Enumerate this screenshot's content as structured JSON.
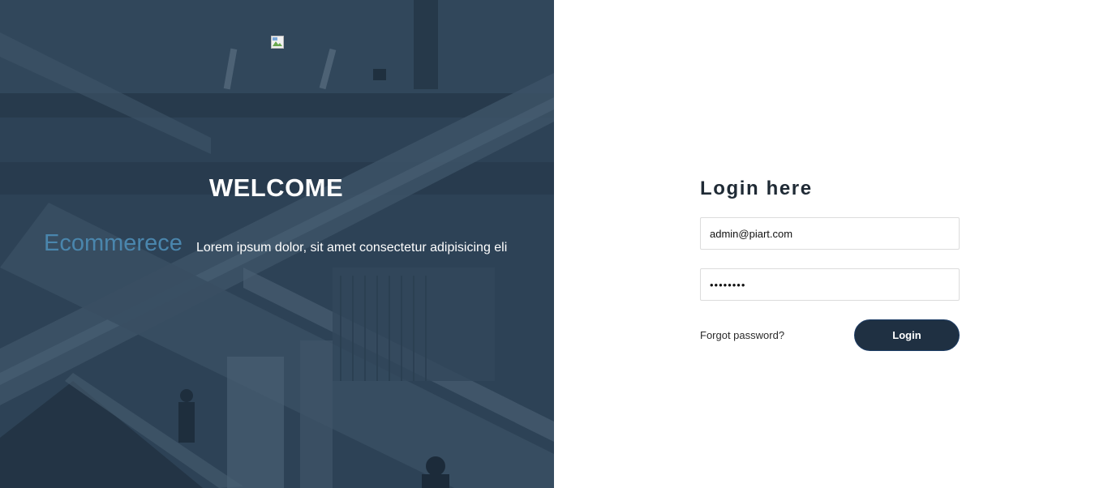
{
  "hero": {
    "logo_icon": "broken-image-icon",
    "title": "WELCOME",
    "brand": "Ecommerece",
    "tagline": "Lorem ipsum dolor, sit amet consectetur adipisicing eli",
    "background_image": "escalators-in-shopping-mall",
    "colors": {
      "overlay": "#2f4559",
      "brand": "#4a86ad",
      "text": "#ffffff"
    }
  },
  "login": {
    "title": "Login here",
    "email": {
      "value": "admin@piart.com"
    },
    "password": {
      "value": "••••••••"
    },
    "forgot_label": "Forgot password?",
    "submit_label": "Login",
    "colors": {
      "button": "#1f3042",
      "button_border": "#1d3d66",
      "title": "#1f2a35"
    }
  }
}
